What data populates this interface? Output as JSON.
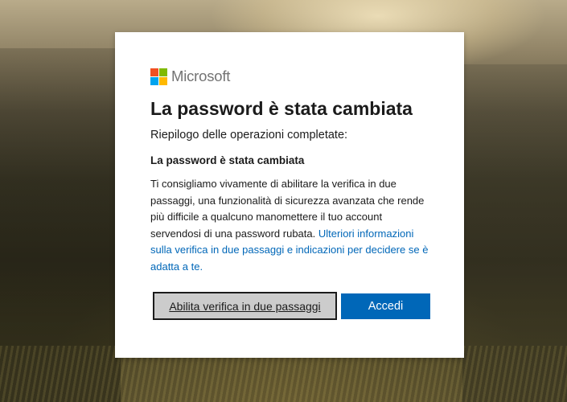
{
  "brand": {
    "name": "Microsoft",
    "colors": {
      "red": "#f25022",
      "green": "#7fba00",
      "blue": "#00a4ef",
      "yellow": "#ffb900"
    }
  },
  "page": {
    "title": "La password è stata cambiata",
    "subtitle": "Riepilogo delle operazioni completate:",
    "section_title": "La password è stata cambiata",
    "body_text": "Ti consigliamo vivamente di abilitare la verifica in due passaggi, una funzionalità di sicurezza avanzata che rende più difficile a qualcuno manomettere il tuo account servendosi di una password rubata. ",
    "link_text": "Ulteriori informazioni sulla verifica in due passaggi e indicazioni per decidere se è adatta a te."
  },
  "buttons": {
    "secondary_label": "Abilita verifica in due passaggi",
    "primary_label": "Accedi"
  },
  "colors": {
    "accent": "#0067b8",
    "secondary_bg": "#cccccc",
    "text": "#1b1b1b"
  }
}
